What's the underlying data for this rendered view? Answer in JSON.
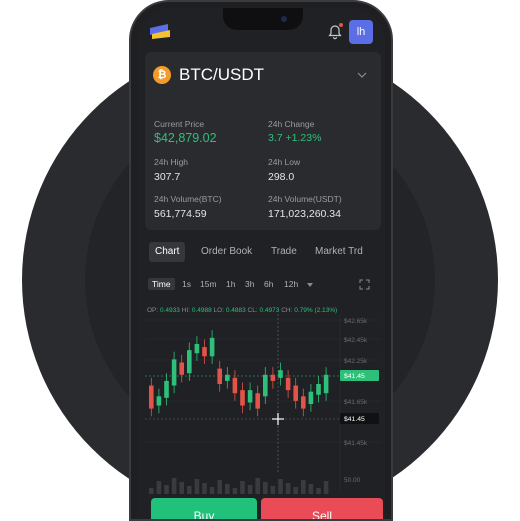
{
  "header": {
    "avatar_text": "lh"
  },
  "pair": {
    "symbol": "BTC/USDT",
    "coin_letter": "₿"
  },
  "stats": {
    "current_price_label": "Current Price",
    "current_price_value": "$42,879.02",
    "change_label": "24h Change",
    "change_value": "3.7  +1.23%",
    "high_label": "24h High",
    "high_value": "307.7",
    "low_label": "24h Low",
    "low_value": "298.0",
    "vol_btc_label": "24h Volume(BTC)",
    "vol_btc_value": "561,774.59",
    "vol_usdt_label": "24h Volume(USDT)",
    "vol_usdt_value": "171,023,260.34"
  },
  "tabs": [
    "Chart",
    "Order Book",
    "Trade",
    "Market Trd"
  ],
  "timeframes": [
    "Time",
    "1s",
    "15m",
    "1h",
    "3h",
    "6h",
    "12h"
  ],
  "ohlc": {
    "op_label": "OP:",
    "op": "0.4933",
    "hi_label": "HI:",
    "hi": "0.4988",
    "lo_label": "LO:",
    "lo": "0.4883",
    "cl_label": "CL:",
    "cl": "0.4973",
    "ch_label": "CH:",
    "ch": "0.79% (2.13%)"
  },
  "price_axis": [
    "$42.65k",
    "$42.45k",
    "$42.25k",
    "$41.45",
    "$41.65k",
    "$41.45",
    "$41.45k",
    "50.00"
  ],
  "current_price_tag": "$41.45",
  "crosshair_price_tag": "$41.45",
  "actions": {
    "buy": "Buy",
    "sell": "Sell"
  },
  "colors": {
    "up": "#2ec07a",
    "down": "#e2534a",
    "buy": "#22c17b",
    "sell": "#e94b57"
  },
  "chart_data": {
    "type": "candlestick",
    "candles": [
      {
        "o": 41.55,
        "c": 41.4
      },
      {
        "o": 41.42,
        "c": 41.48
      },
      {
        "o": 41.47,
        "c": 41.58
      },
      {
        "o": 41.55,
        "c": 41.72
      },
      {
        "o": 41.7,
        "c": 41.62
      },
      {
        "o": 41.63,
        "c": 41.78
      },
      {
        "o": 41.76,
        "c": 41.82
      },
      {
        "o": 41.8,
        "c": 41.74
      },
      {
        "o": 41.74,
        "c": 41.86
      },
      {
        "o": 41.66,
        "c": 41.56
      },
      {
        "o": 41.58,
        "c": 41.62
      },
      {
        "o": 41.6,
        "c": 41.5
      },
      {
        "o": 41.52,
        "c": 41.42
      },
      {
        "o": 41.44,
        "c": 41.52
      },
      {
        "o": 41.5,
        "c": 41.4
      },
      {
        "o": 41.48,
        "c": 41.62
      },
      {
        "o": 41.62,
        "c": 41.58
      },
      {
        "o": 41.6,
        "c": 41.65
      },
      {
        "o": 41.6,
        "c": 41.52
      },
      {
        "o": 41.55,
        "c": 41.45
      },
      {
        "o": 41.48,
        "c": 41.4
      },
      {
        "o": 41.43,
        "c": 41.51
      },
      {
        "o": 41.49,
        "c": 41.56
      },
      {
        "o": 41.5,
        "c": 41.62
      }
    ]
  }
}
